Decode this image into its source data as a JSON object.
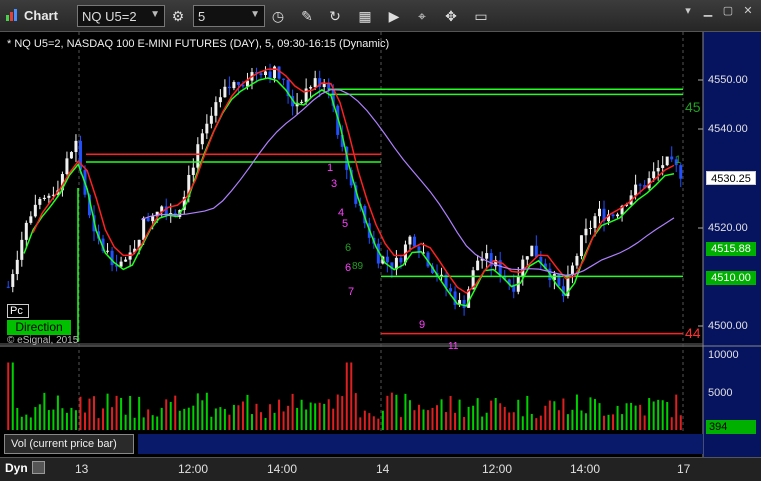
{
  "toolbar": {
    "app_title": "Chart",
    "symbol": "NQ U5=2",
    "interval": "5"
  },
  "legend": "* NQ U5=2, NASDAQ 100 E-MINI FUTURES (DAY), 5, 09:30-16:15 (Dynamic)",
  "price_axis": {
    "ticks": [
      "4550.00",
      "4540.00",
      "4520.00",
      "4500.00"
    ],
    "last_price": "4530.25",
    "level_1": "4515.88",
    "level_2": "4510.00"
  },
  "volume_axis": {
    "ticks": [
      "10000",
      "5000"
    ],
    "last_volume": "394"
  },
  "time_axis": [
    "13",
    "12:00",
    "14:00",
    "14",
    "12:00",
    "14:00",
    "17"
  ],
  "tags": {
    "pc": "Pc",
    "direction": "Direction",
    "copyright": "© eSignal, 2015",
    "vol_label": "Vol (current price bar)",
    "dyn": "Dyn"
  },
  "annotations": {
    "label_45": "45",
    "label_44": "44",
    "count_1a": "1",
    "count_1b": "1",
    "count_3": "3",
    "count_4": "4",
    "count_5": "5",
    "count_6": "6",
    "count_6b": "6",
    "count_7": "7",
    "count_9": "9",
    "count_11": "11",
    "count_89": "89"
  },
  "colors": {
    "up": "#f0f0f0",
    "down": "#2050ff",
    "green_line": "#20ff20",
    "red_line": "#ff2020",
    "purple_line": "#b080ff",
    "vol_up": "#00d000",
    "vol_down": "#e02020",
    "vol_tag": "#00b000"
  },
  "chart_data": {
    "type": "candlestick",
    "ylim": [
      4497,
      4557
    ],
    "close_path": [
      4508,
      4520,
      4524,
      4528,
      4536,
      4518,
      4514,
      4512,
      4520,
      4524,
      4522,
      4532,
      4540,
      4546,
      4548,
      4550,
      4549,
      4543,
      4547,
      4548,
      4532,
      4522,
      4514,
      4512,
      4518,
      4513,
      4508,
      4504,
      4514,
      4512,
      4508,
      4516,
      4512,
      4506,
      4516,
      4522,
      4522,
      4526,
      4528,
      4532,
      4530
    ]
  }
}
